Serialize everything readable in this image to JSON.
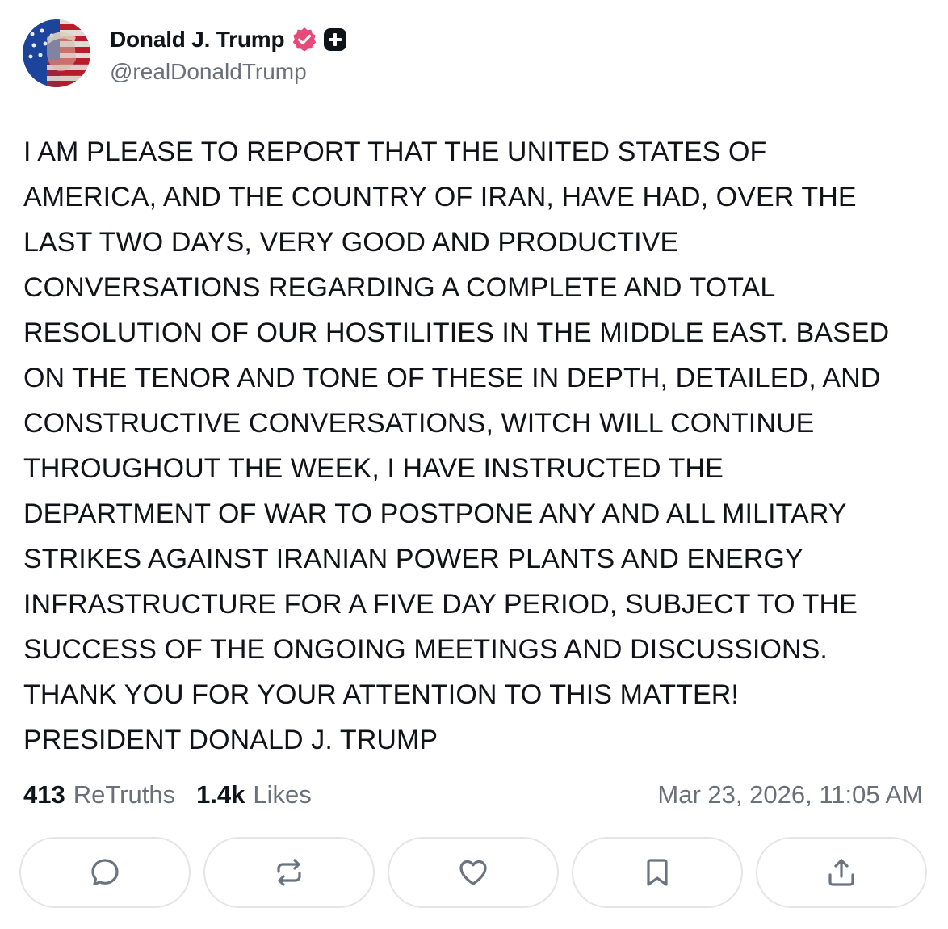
{
  "author": {
    "display_name": "Donald J. Trump",
    "handle": "@realDonaldTrump",
    "avatar_icon": "flag-portrait-avatar",
    "verified_icon": "verified-badge-icon",
    "verified_color": "#e7497b",
    "plus_icon": "plus-badge-icon"
  },
  "post": {
    "lines": [
      "I AM PLEASE TO REPORT THAT THE UNITED STATES OF",
      "AMERICA, AND THE COUNTRY OF IRAN, HAVE HAD, OVER THE",
      "LAST TWO DAYS, VERY GOOD AND PRODUCTIVE",
      "CONVERSATIONS REGARDING A COMPLETE AND TOTAL",
      "RESOLUTION OF OUR HOSTILITIES IN THE MIDDLE EAST. BASED",
      "ON THE TENOR AND TONE OF THESE IN DEPTH, DETAILED, AND",
      "CONSTRUCTIVE CONVERSATIONS, WITCH WILL CONTINUE",
      "THROUGHOUT THE WEEK, I HAVE INSTRUCTED THE",
      "DEPARTMENT OF WAR TO POSTPONE ANY AND ALL MILITARY",
      "STRIKES AGAINST IRANIAN POWER PLANTS AND ENERGY",
      "INFRASTRUCTURE FOR A FIVE DAY PERIOD, SUBJECT TO THE",
      "SUCCESS OF THE ONGOING MEETINGS AND DISCUSSIONS.",
      "THANK YOU FOR YOUR ATTENTION TO THIS MATTER!",
      "PRESIDENT DONALD J. TRUMP"
    ]
  },
  "stats": {
    "retruths_count": "413",
    "retruths_label": "ReTruths",
    "likes_count": "1.4k",
    "likes_label": "Likes",
    "timestamp": "Mar 23, 2026, 11:05 AM"
  },
  "actions": [
    {
      "name": "reply",
      "icon": "reply-bubble-icon"
    },
    {
      "name": "retruth",
      "icon": "retruth-arrows-icon"
    },
    {
      "name": "like",
      "icon": "heart-icon"
    },
    {
      "name": "bookmark",
      "icon": "bookmark-icon"
    },
    {
      "name": "share",
      "icon": "share-upload-icon"
    }
  ],
  "colors": {
    "text_primary": "#0f1419",
    "text_secondary": "#6b6f7a",
    "border": "#e3e5e9",
    "icon": "#6b7280"
  }
}
